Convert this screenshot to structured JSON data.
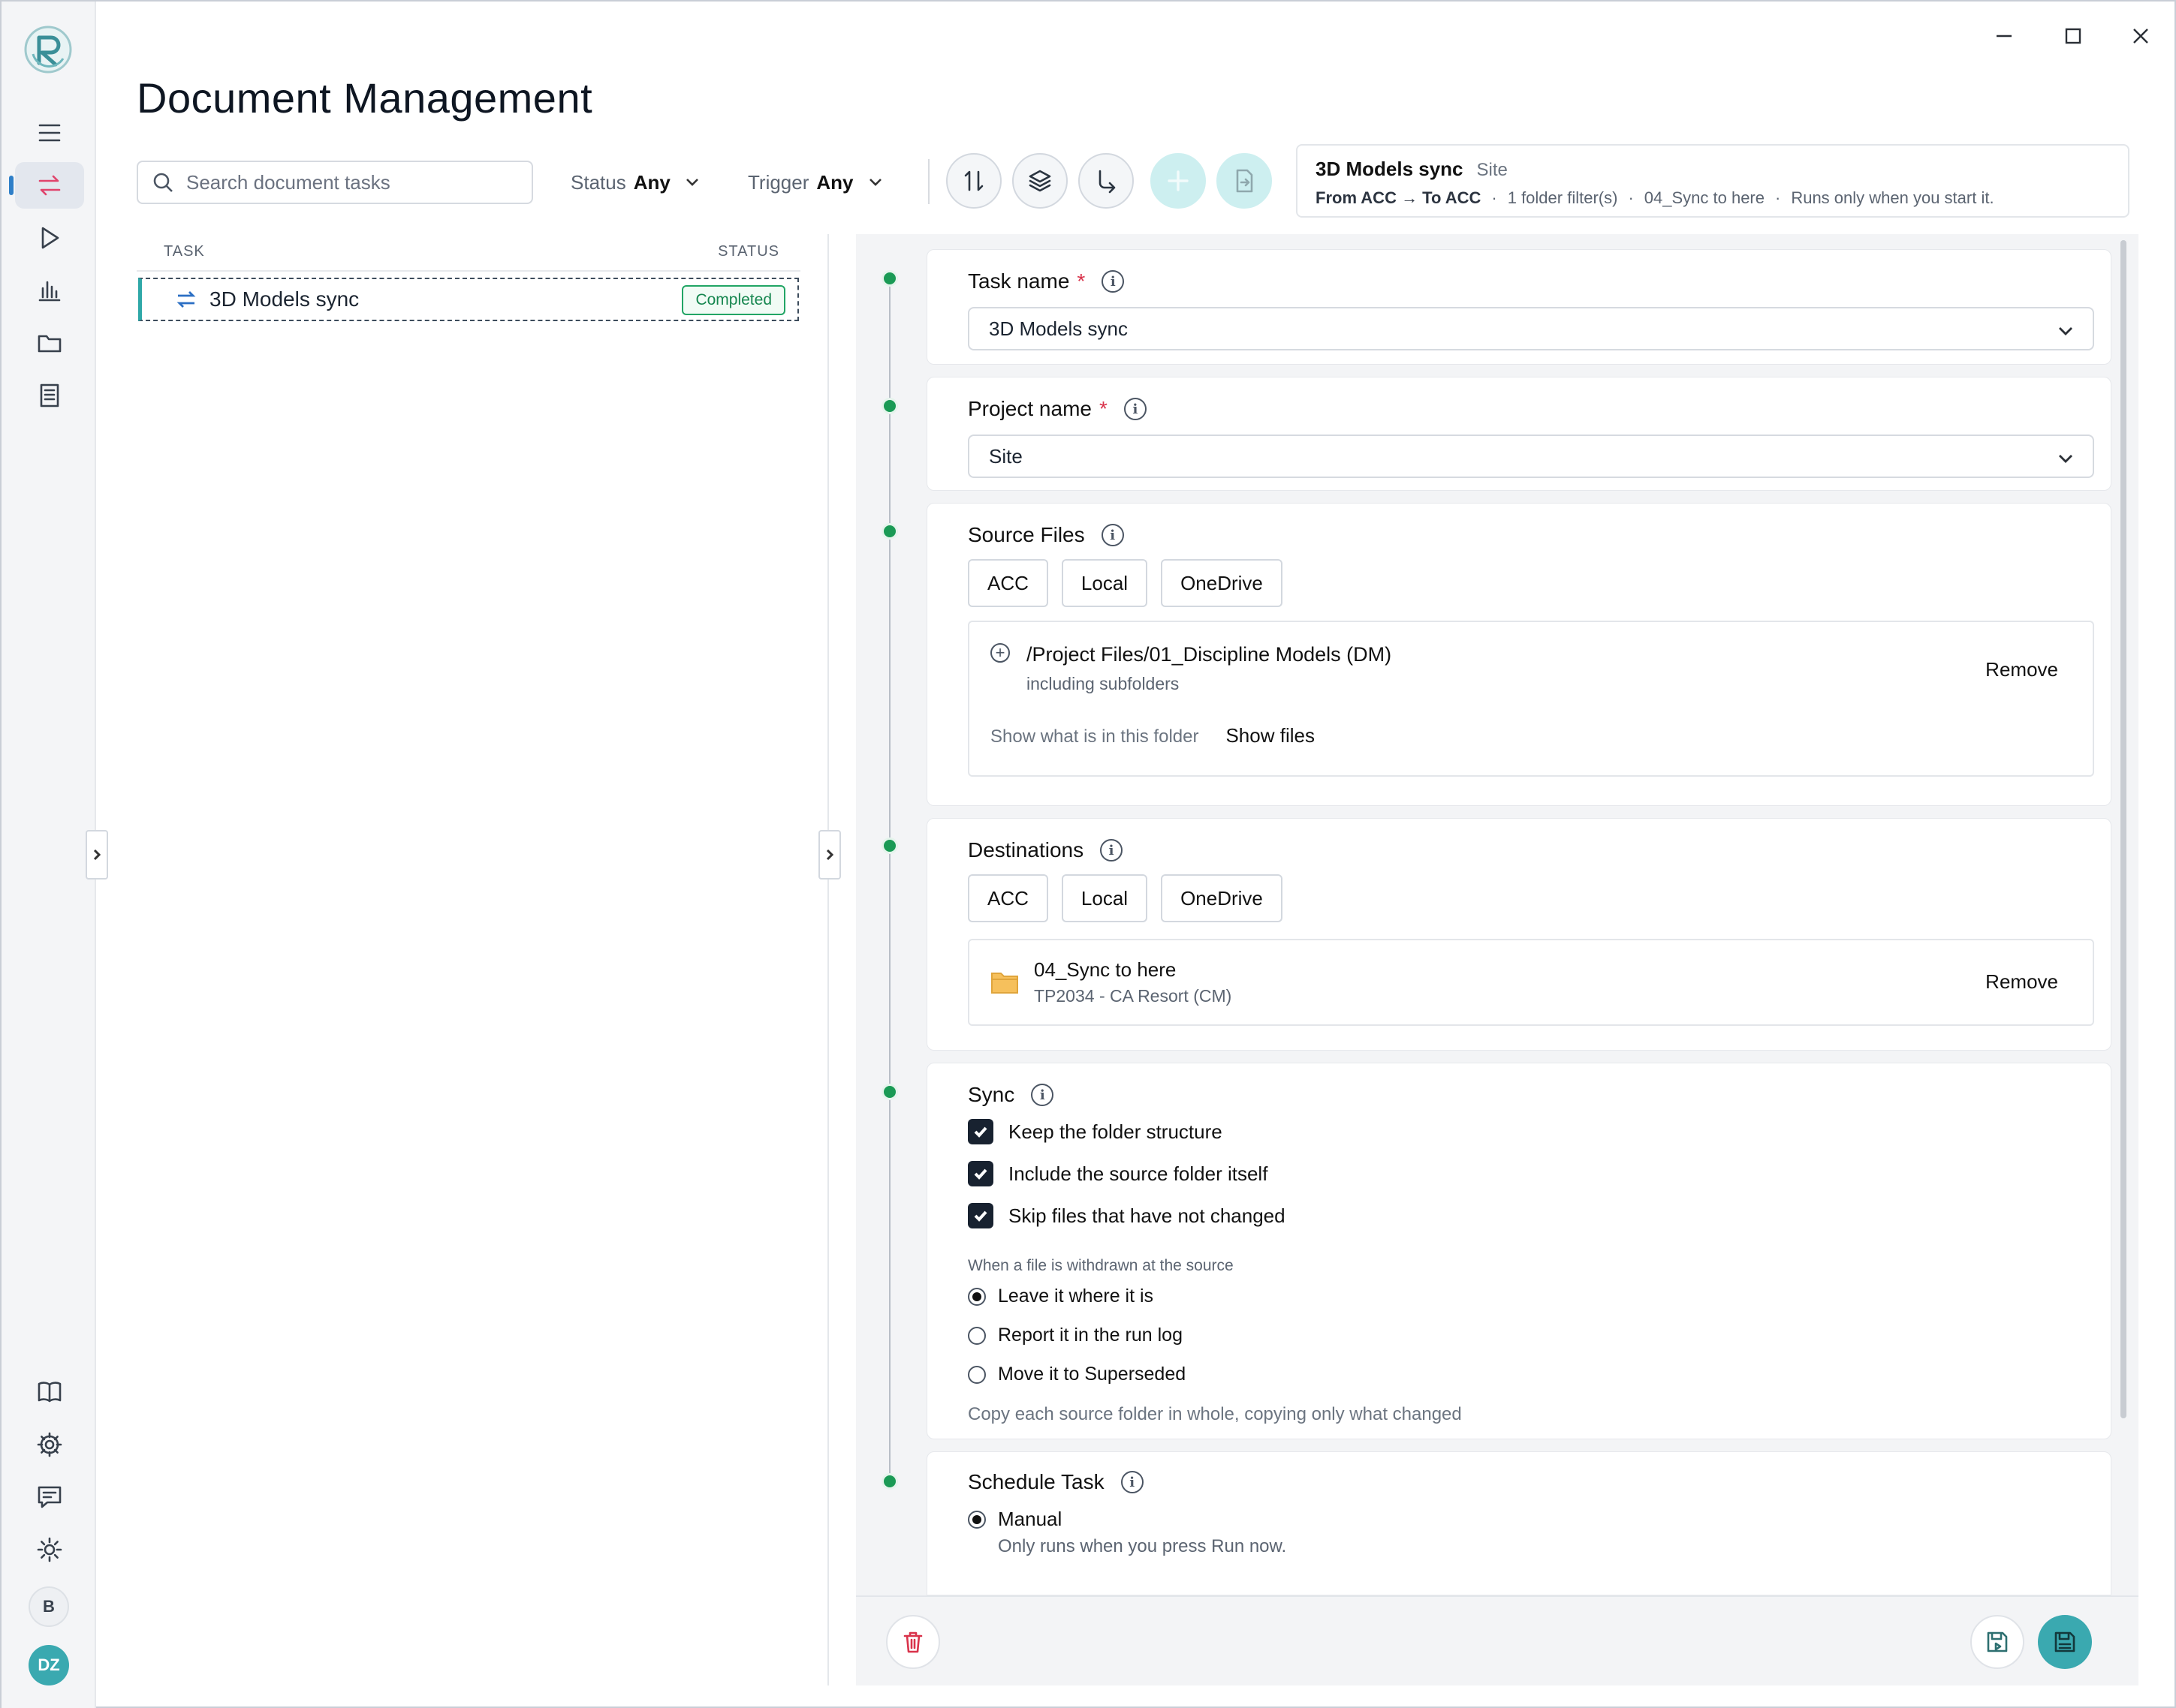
{
  "page": {
    "title": "Document Management"
  },
  "window_controls": {
    "minimize": "minimize",
    "maximize": "maximize",
    "close": "close"
  },
  "rail": {
    "items": [
      "menu-icon",
      "sync-arrows-icon",
      "play-icon",
      "bar-chart-icon",
      "folder-icon",
      "document-icon"
    ],
    "bottom": [
      "book-icon",
      "gear-icon",
      "feedback-icon",
      "sun-icon"
    ],
    "avatar_b": "B",
    "avatar_user": "DZ"
  },
  "search": {
    "placeholder": "Search document tasks",
    "value": ""
  },
  "filters": {
    "status": {
      "label": "Status",
      "value": "Any"
    },
    "trigger": {
      "label": "Trigger",
      "value": "Any"
    }
  },
  "summary": {
    "task_name": "3D Models sync",
    "project": "Site",
    "direction": "From ACC → To ACC",
    "folder_filters": "1 folder filter(s)",
    "destination": "04_Sync to here",
    "trigger": "Runs only when you start it.",
    "separator": "·"
  },
  "task_list": {
    "col_task": "TASK",
    "col_status": "STATUS",
    "rows": [
      {
        "name": "3D Models sync",
        "status": "Completed"
      }
    ]
  },
  "form": {
    "task_name": {
      "label": "Task name",
      "required": "*",
      "value": "3D Models sync"
    },
    "project_name": {
      "label": "Project name",
      "required": "*",
      "value": "Site"
    },
    "source_files": {
      "label": "Source Files",
      "options": [
        "ACC",
        "Local",
        "OneDrive"
      ],
      "path": "/Project Files/01_Discipline Models (DM)",
      "subfolders": "including subfolders",
      "remove": "Remove",
      "hint": "Show what is in this folder",
      "show_files": "Show files",
      "expand": "+"
    },
    "destinations": {
      "label": "Destinations",
      "options": [
        "ACC",
        "Local",
        "OneDrive"
      ],
      "folder": "04_Sync to here",
      "project": "TP2034 - CA Resort (CM)",
      "remove": "Remove"
    },
    "sync": {
      "label": "Sync",
      "checks": [
        {
          "label": "Keep the folder structure",
          "checked": true
        },
        {
          "label": "Include the source folder itself",
          "checked": true
        },
        {
          "label": "Skip files that have not changed",
          "checked": true
        }
      ],
      "withdrawn_label": "When a file is withdrawn at the source",
      "withdrawn_options": [
        {
          "label": "Leave it where it is",
          "selected": true
        },
        {
          "label": "Report it in the run log",
          "selected": false
        },
        {
          "label": "Move it to Superseded",
          "selected": false
        }
      ],
      "note": "Copy each source folder in whole, copying only what changed"
    },
    "schedule": {
      "label": "Schedule Task",
      "option": "Manual",
      "option_desc": "Only runs when you press Run now."
    }
  },
  "colors": {
    "accent_teal": "#3aa9b0",
    "success": "#1a9a55",
    "danger": "#d9334b",
    "active_nav": "#e0446c"
  }
}
